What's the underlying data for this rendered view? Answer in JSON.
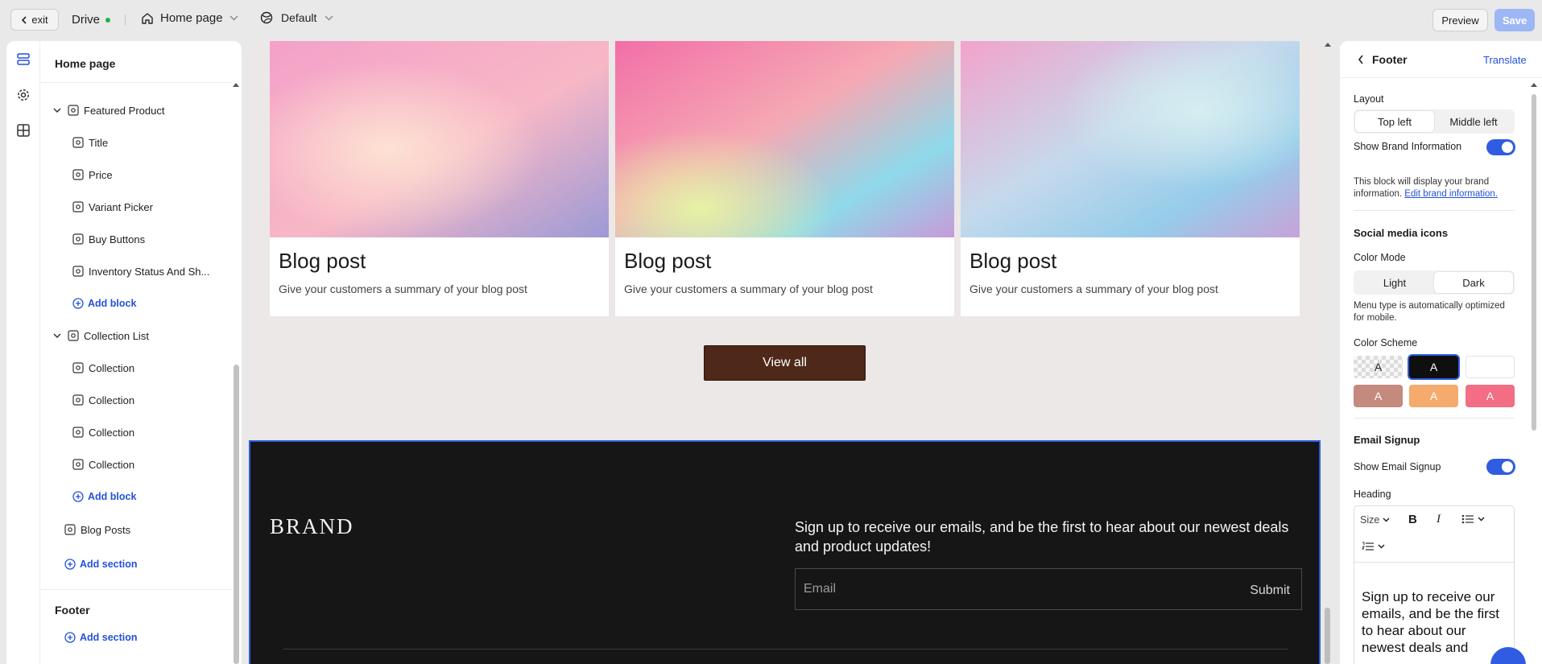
{
  "topbar": {
    "exit_label": "exit",
    "store_name": "Drive",
    "status_color": "#22b04b",
    "page_selector": "Home page",
    "theme_selector": "Default",
    "preview_label": "Preview",
    "save_label": "Save"
  },
  "left_panel": {
    "title": "Home page",
    "tree": {
      "featured_product": "Featured Product",
      "featured_children": [
        "Title",
        "Price",
        "Variant Picker",
        "Buy Buttons",
        "Inventory Status And Sh..."
      ],
      "add_block": "Add block",
      "collection_list": "Collection List",
      "collection_children": [
        "Collection",
        "Collection",
        "Collection",
        "Collection"
      ],
      "blog_posts": "Blog Posts",
      "add_section": "Add section"
    },
    "footer_title": "Footer",
    "footer_add_section": "Add section"
  },
  "canvas": {
    "blog_cards": [
      {
        "title": "Blog post",
        "summary": "Give your customers a summary of your blog post"
      },
      {
        "title": "Blog post",
        "summary": "Give your customers a summary of your blog post"
      },
      {
        "title": "Blog post",
        "summary": "Give your customers a summary of your blog post"
      }
    ],
    "view_all_label": "View all",
    "footer": {
      "brand": "BRAND",
      "signup_text": "Sign up to receive our emails, and be the first to hear about our newest deals and product updates!",
      "email_placeholder": "Email",
      "submit_label": "Submit"
    },
    "selection_color": "#2b5fd9"
  },
  "right_panel": {
    "title": "Footer",
    "translate_label": "Translate",
    "layout_label": "Layout",
    "layout_options": [
      "Top left",
      "Middle left"
    ],
    "layout_selected": "Top left",
    "show_brand_label": "Show Brand Information",
    "show_brand_on": true,
    "brand_note": "This block will display your brand information.",
    "brand_link": "Edit brand information.",
    "social_heading": "Social media icons",
    "color_mode_label": "Color Mode",
    "color_mode_options": [
      "Light",
      "Dark"
    ],
    "color_mode_selected": "Dark",
    "color_mode_note": "Menu type is automatically optimized for mobile.",
    "color_scheme_label": "Color Scheme",
    "color_scheme_swatches": [
      "A",
      "A",
      "",
      "A",
      "A",
      "A"
    ],
    "email_signup_heading": "Email Signup",
    "show_email_label": "Show Email Signup",
    "show_email_on": true,
    "heading_label": "Heading",
    "editor_size_label": "Size",
    "editor_bold": "B",
    "editor_italic": "I",
    "editor_text": "Sign up to receive our emails, and be the first to hear about our newest deals and",
    "accent_color": "#2f5ce0"
  }
}
